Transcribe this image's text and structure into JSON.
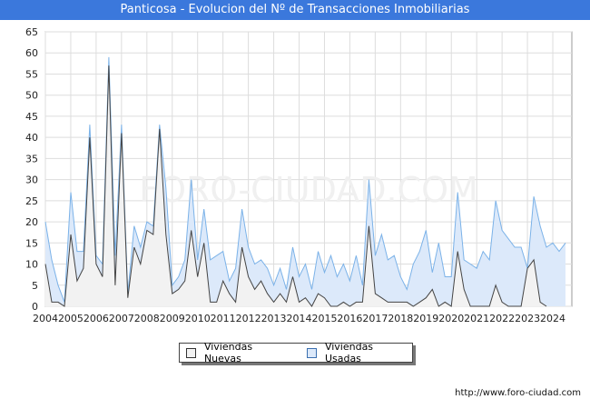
{
  "title": "Panticosa - Evolucion del Nº de Transacciones Inmobiliarias",
  "credit": "http://www.foro-ciudad.com",
  "watermark": "FORO-CIUDAD.COM",
  "chart_data": {
    "type": "area",
    "title": "Panticosa - Evolucion del Nº de Transacciones Inmobiliarias",
    "xlabel": "",
    "ylabel": "",
    "ylim": [
      0,
      65
    ],
    "yticks": [
      0,
      5,
      10,
      15,
      20,
      25,
      30,
      35,
      40,
      45,
      50,
      55,
      60,
      65
    ],
    "xlim": [
      2004,
      2024.75
    ],
    "xticks": [
      "2004",
      "2005",
      "2006",
      "2007",
      "2008",
      "2009",
      "2010",
      "2011",
      "2012",
      "2013",
      "2014",
      "2015",
      "2016",
      "2017",
      "2018",
      "2019",
      "2020",
      "2021",
      "2022",
      "2023",
      "2024"
    ],
    "grid": true,
    "legend_position": "bottom",
    "x_quarters": "2004-Q1 to 2024-Q4",
    "series": [
      {
        "name": "Viviendas Nuevas",
        "color": "#f2f2f2",
        "stroke": "#444444",
        "values": [
          10,
          1,
          1,
          0,
          17,
          6,
          9,
          40,
          10,
          7,
          57,
          5,
          41,
          2,
          14,
          10,
          18,
          17,
          42,
          17,
          3,
          4,
          6,
          18,
          7,
          15,
          1,
          1,
          6,
          3,
          1,
          14,
          7,
          4,
          6,
          3,
          1,
          3,
          1,
          7,
          1,
          2,
          0,
          3,
          2,
          0,
          0,
          1,
          0,
          1,
          1,
          19,
          3,
          2,
          1,
          1,
          1,
          1,
          0,
          1,
          2,
          4,
          0,
          1,
          0,
          13,
          4,
          0,
          0,
          0,
          0,
          5,
          1,
          0,
          0,
          0,
          9,
          11,
          1,
          0
        ]
      },
      {
        "name": "Viviendas Usadas",
        "color": "#dce9fa",
        "stroke": "#7bb2e8",
        "values": [
          20,
          11,
          5,
          1,
          27,
          13,
          13,
          43,
          12,
          10,
          59,
          12,
          43,
          3,
          19,
          14,
          20,
          19,
          43,
          28,
          5,
          7,
          11,
          30,
          11,
          23,
          11,
          12,
          13,
          6,
          9,
          23,
          14,
          10,
          11,
          9,
          5,
          9,
          4,
          14,
          7,
          10,
          4,
          13,
          8,
          12,
          7,
          10,
          6,
          12,
          5,
          30,
          12,
          17,
          11,
          12,
          7,
          4,
          10,
          13,
          18,
          8,
          15,
          7,
          7,
          27,
          11,
          10,
          9,
          13,
          11,
          25,
          18,
          16,
          14,
          14,
          9,
          26,
          19,
          14,
          15,
          13,
          15
        ]
      }
    ]
  }
}
